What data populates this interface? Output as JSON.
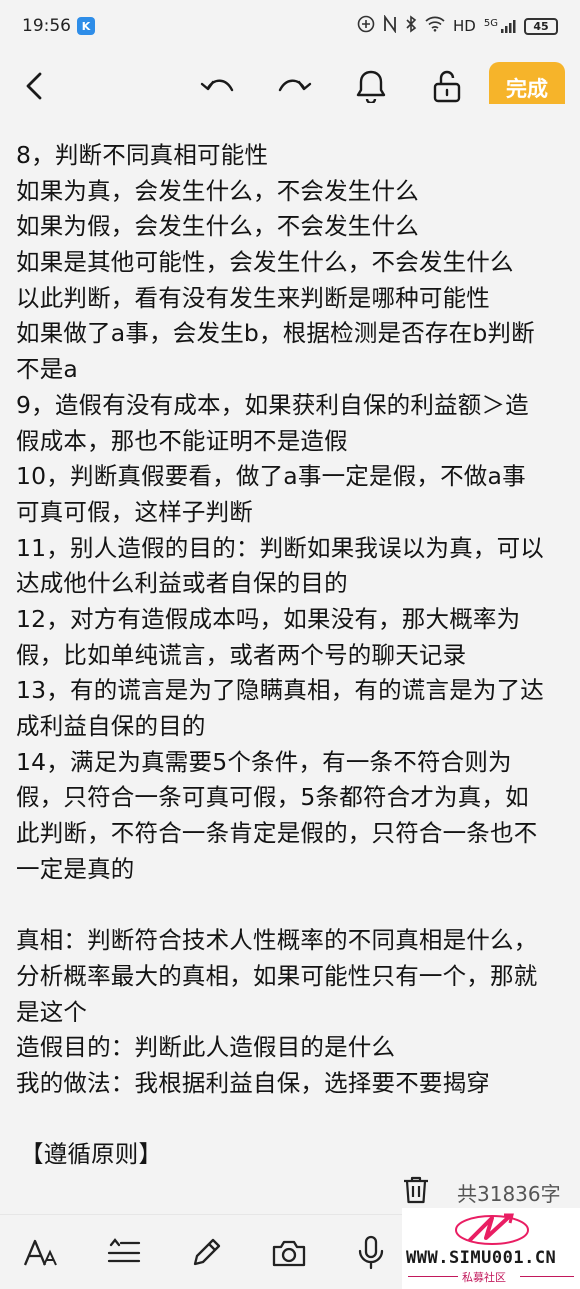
{
  "status": {
    "time": "19:56",
    "app_badge": "K",
    "network": "HD",
    "signal": "5G",
    "battery": "45"
  },
  "toolbar": {
    "done_label": "完成"
  },
  "note": {
    "lines": [
      "8，判断不同真相可能性",
      "如果为真，会发生什么，不会发生什么",
      "如果为假，会发生什么，不会发生什么",
      "如果是其他可能性，会发生什么，不会发生什么",
      "以此判断，看有没有发生来判断是哪种可能性",
      "如果做了a事，会发生b，根据检测是否存在b判断",
      "不是a",
      "9，造假有没有成本，如果获利自保的利益额＞造",
      "假成本，那也不能证明不是造假",
      "10，判断真假要看，做了a事一定是假，不做a事",
      "可真可假，这样子判断",
      "11，别人造假的目的：判断如果我误以为真，可以",
      "达成他什么利益或者自保的目的",
      "12，对方有造假成本吗，如果没有，那大概率为",
      "假，比如单纯谎言，或者两个号的聊天记录",
      "13，有的谎言是为了隐瞒真相，有的谎言是为了达",
      "成利益自保的目的",
      "14，满足为真需要5个条件，有一条不符合则为",
      "假，只符合一条可真可假，5条都符合才为真，如",
      "此判断，不符合一条肯定是假的，只符合一条也不",
      "一定是真的",
      "",
      "真相：判断符合技术人性概率的不同真相是什么，",
      "分析概率最大的真相，如果可能性只有一个，那就",
      "是这个",
      "造假目的：判断此人造假目的是什么",
      "我的做法：我根据利益自保，选择要不要揭穿",
      "",
      "【遵循原则】"
    ]
  },
  "footer": {
    "word_count": "共31836字"
  },
  "watermark": {
    "site": "WWW.SIMU001.CN",
    "subtitle": "私募社区"
  }
}
